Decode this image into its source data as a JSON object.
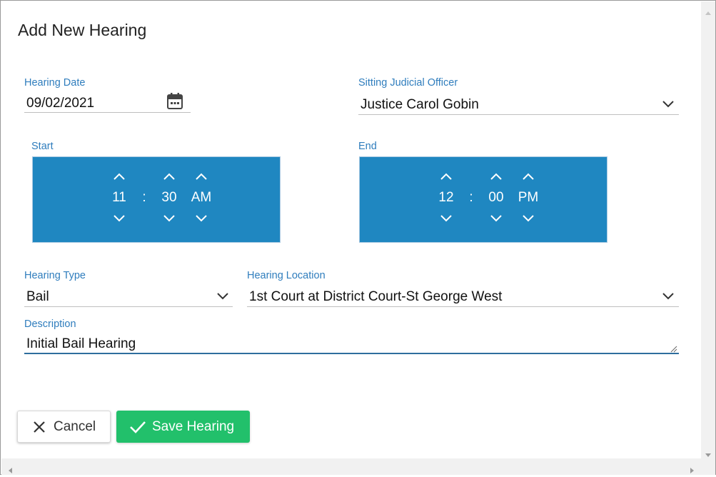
{
  "dialog": {
    "title": "Add New Hearing"
  },
  "hearing_date": {
    "label": "Hearing Date",
    "value": "09/02/2021",
    "icon": "calendar-icon"
  },
  "judicial_officer": {
    "label": "Sitting Judicial Officer",
    "value": "Justice Carol Gobin"
  },
  "start": {
    "label": "Start",
    "hour": "11",
    "sep": ":",
    "minute": "30",
    "period": "AM"
  },
  "end": {
    "label": "End",
    "hour": "12",
    "sep": ":",
    "minute": "00",
    "period": "PM"
  },
  "hearing_type": {
    "label": "Hearing Type",
    "value": "Bail"
  },
  "hearing_location": {
    "label": "Hearing Location",
    "value": "1st Court at District Court-St George West"
  },
  "description": {
    "label": "Description",
    "value": "Initial Bail Hearing"
  },
  "actions": {
    "cancel_label": "Cancel",
    "save_label": "Save Hearing"
  },
  "colors": {
    "accent": "#1f87c1",
    "label_blue": "#2f7dbd",
    "save_green": "#22c06b"
  }
}
